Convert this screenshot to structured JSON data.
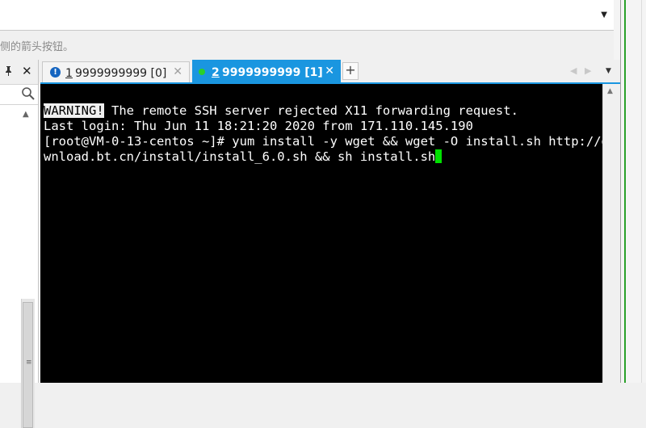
{
  "top": {
    "hint_text": "侧的箭头按钮。"
  },
  "left_pane": {
    "pin_glyph": "📌",
    "close_glyph": "✕"
  },
  "tabs": [
    {
      "number": "1",
      "title": " 9999999999 [0]",
      "status_glyph": "!",
      "active": false
    },
    {
      "number": "2",
      "title": " 9999999999 [1]",
      "active": true
    }
  ],
  "tab_strip": {
    "new_tab_glyph": "+"
  },
  "terminal": {
    "warning_label": "WARNING!",
    "warning_rest": " The remote SSH server rejected X11 forwarding request.",
    "last_login": "Last login: Thu Jun 11 18:21:20 2020 from 171.110.145.190",
    "command_line_1": "[root@VM-0-13-centos ~]# yum install -y wget && wget -O install.sh http://do",
    "command_line_2": "wnload.bt.cn/install/install_6.0.sh && sh install.sh"
  },
  "colors": {
    "active_tab": "#1a96e0",
    "terminal_bg": "#000000",
    "cursor": "#00e000",
    "connected_dot": "#2ad02a",
    "status_icon": "#1565c0"
  }
}
